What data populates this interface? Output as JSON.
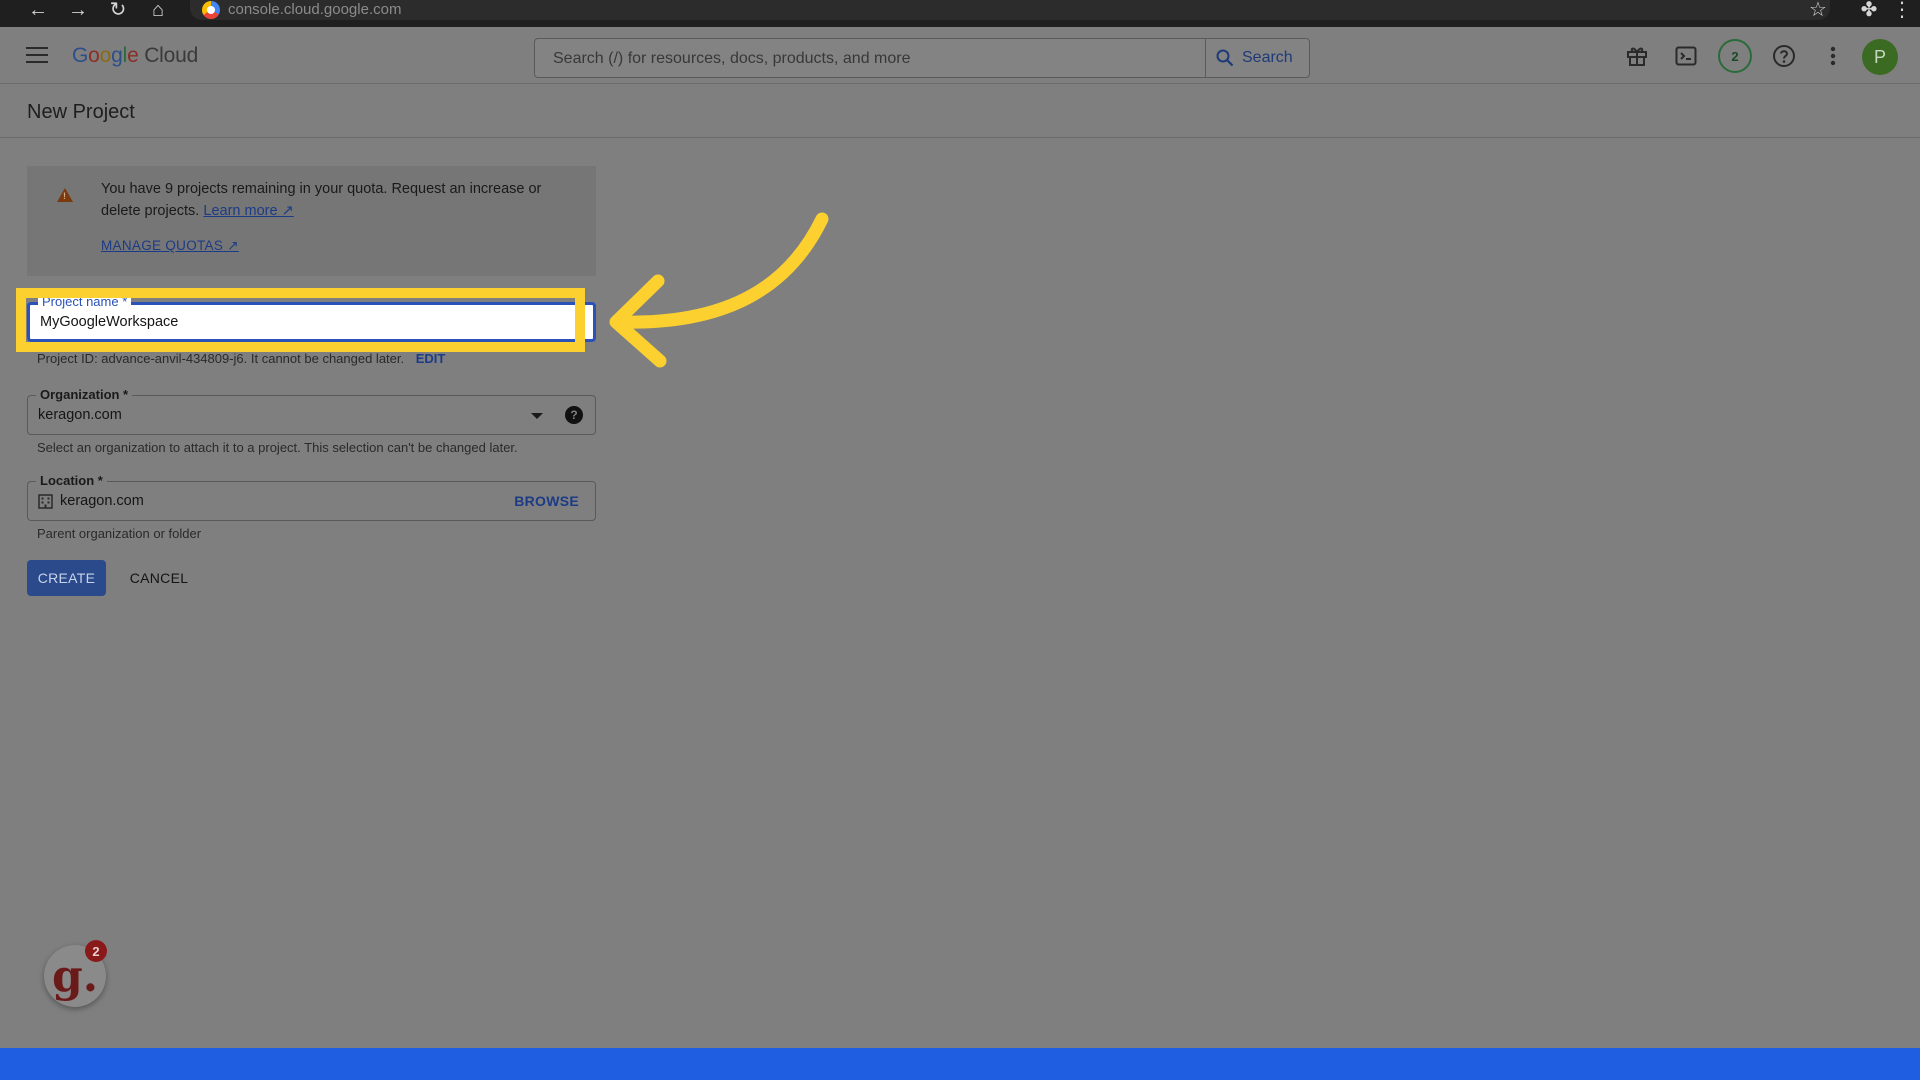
{
  "browser": {
    "url": "console.cloud.google.com"
  },
  "header": {
    "logo_google": [
      "G",
      "o",
      "o",
      "g",
      "l",
      "e"
    ],
    "logo_cloud": "Cloud",
    "search_placeholder": "Search (/) for resources, docs, products, and more",
    "search_button": "Search",
    "notification_count": "2",
    "avatar_initial": "P"
  },
  "page": {
    "title": "New Project"
  },
  "quota_notice": {
    "text": "You have 9 projects remaining in your quota. Request an increase or delete projects.",
    "learn_more": "Learn more",
    "manage_quotas": "MANAGE QUOTAS"
  },
  "form": {
    "project_name_label": "Project name *",
    "project_name_value": "MyGoogleWorkspace",
    "project_id_text": "Project ID: advance-anvil-434809-j6. It cannot be changed later.",
    "project_id_edit": "EDIT",
    "organization_label": "Organization *",
    "organization_value": "keragon.com",
    "organization_helper": "Select an organization to attach it to a project. This selection can't be changed later.",
    "location_label": "Location *",
    "location_value": "keragon.com",
    "location_browse": "BROWSE",
    "location_helper": "Parent organization or folder",
    "create_button": "CREATE",
    "cancel_button": "CANCEL"
  },
  "floating_app": {
    "glyph": "g.",
    "badge": "2"
  },
  "colors": {
    "highlight": "#fcd02f",
    "focus_blue": "#2b52b8",
    "bottom_bar": "#1f5ee0"
  },
  "icons": [
    "back-icon",
    "forward-icon",
    "reload-icon",
    "home-icon",
    "star-icon",
    "extensions-icon",
    "menu-icon",
    "search-icon",
    "gift-icon",
    "terminal-icon",
    "help-icon",
    "more-vert-icon",
    "warning-icon",
    "external-link-icon",
    "dropdown-icon",
    "building-icon"
  ]
}
